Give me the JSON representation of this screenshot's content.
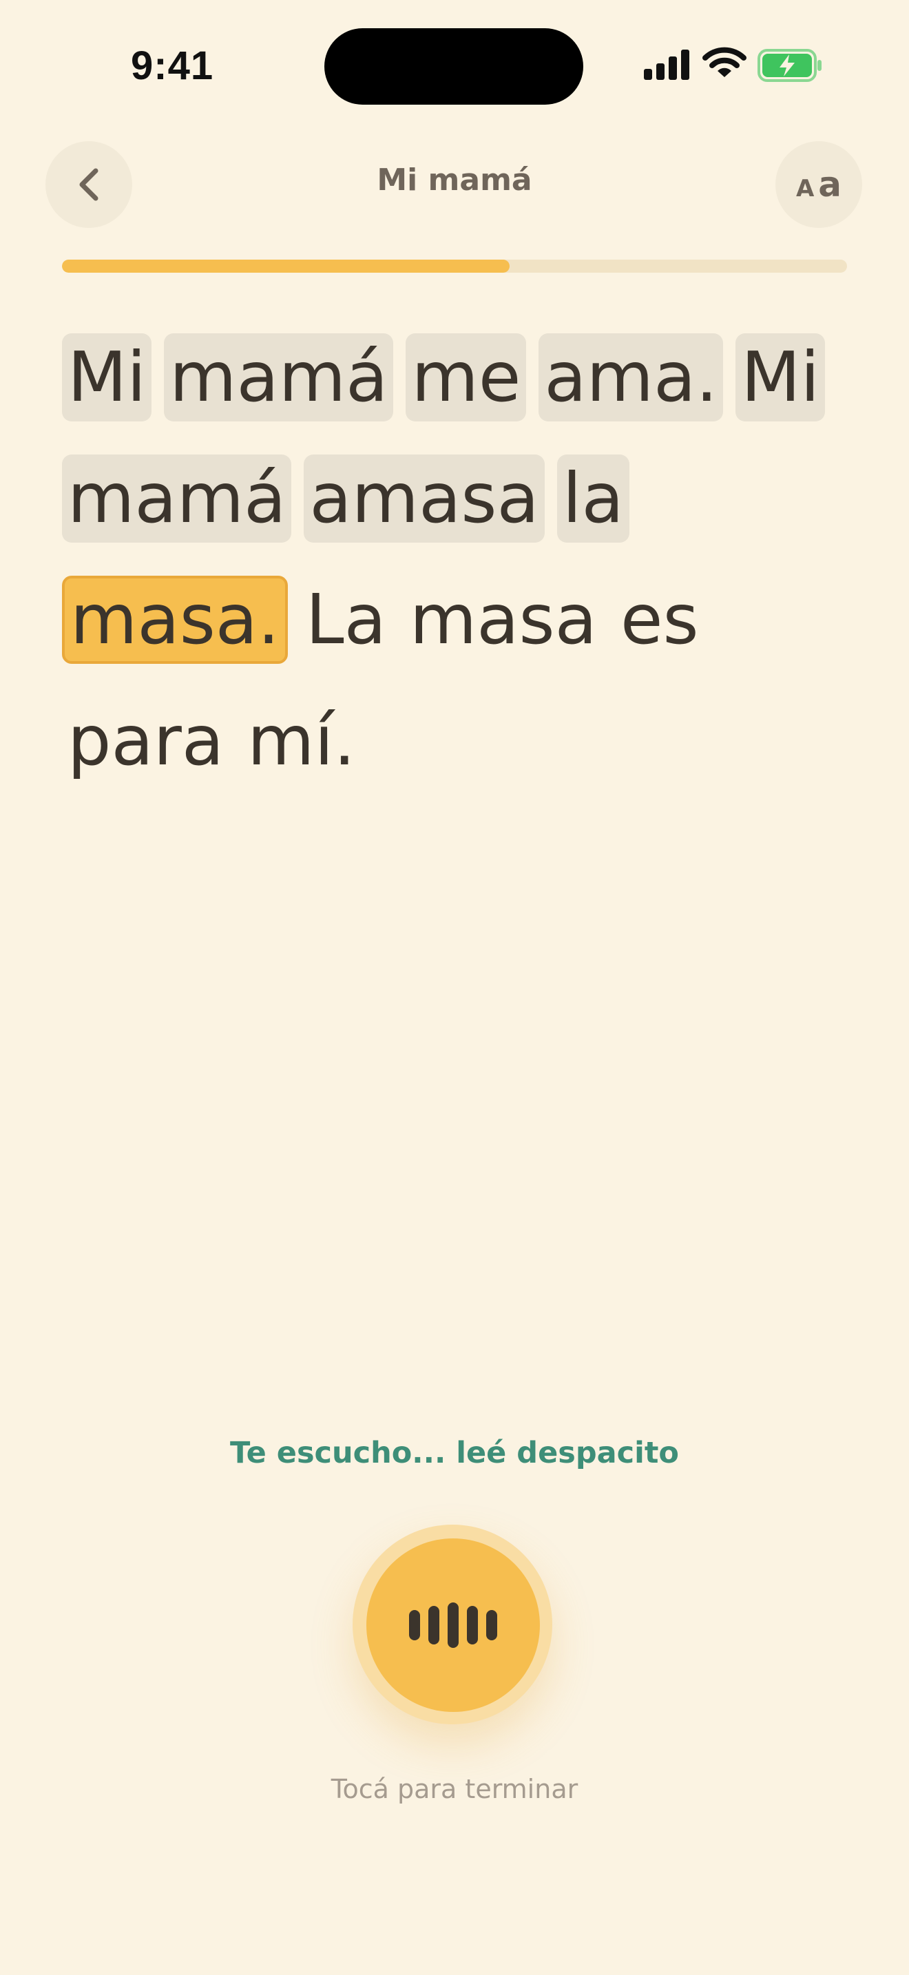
{
  "status_bar": {
    "time": "9:41"
  },
  "header": {
    "title": "Mi mamá",
    "font_small": "A",
    "font_large": "a"
  },
  "progress": {
    "value": 0.57
  },
  "reading": {
    "words": [
      {
        "text": "Mi",
        "state": "read"
      },
      {
        "text": "mamá",
        "state": "read"
      },
      {
        "text": "me",
        "state": "read"
      },
      {
        "text": "ama.",
        "state": "read"
      },
      {
        "text": "Mi",
        "state": "read"
      },
      {
        "text": "mamá",
        "state": "read"
      },
      {
        "text": "amasa",
        "state": "read"
      },
      {
        "text": "la",
        "state": "read"
      },
      {
        "text": "masa.",
        "state": "current"
      },
      {
        "text": "La",
        "state": "pending"
      },
      {
        "text": "masa",
        "state": "pending"
      },
      {
        "text": "es",
        "state": "pending"
      },
      {
        "text": "para",
        "state": "pending"
      },
      {
        "text": "mí.",
        "state": "pending"
      }
    ]
  },
  "listening": {
    "prompt": "Te escucho... leé despacito"
  },
  "mic": {
    "icon": "sound-wave-icon"
  },
  "finish": {
    "hint": "Tocá para terminar"
  },
  "colors": {
    "background": "#FBF3E2",
    "accent": "#F6BE4F",
    "accent_border": "#E9A83A",
    "read_chip": "#E8E1D2",
    "prompt": "#3E8E78",
    "battery": "#3FC45E"
  }
}
